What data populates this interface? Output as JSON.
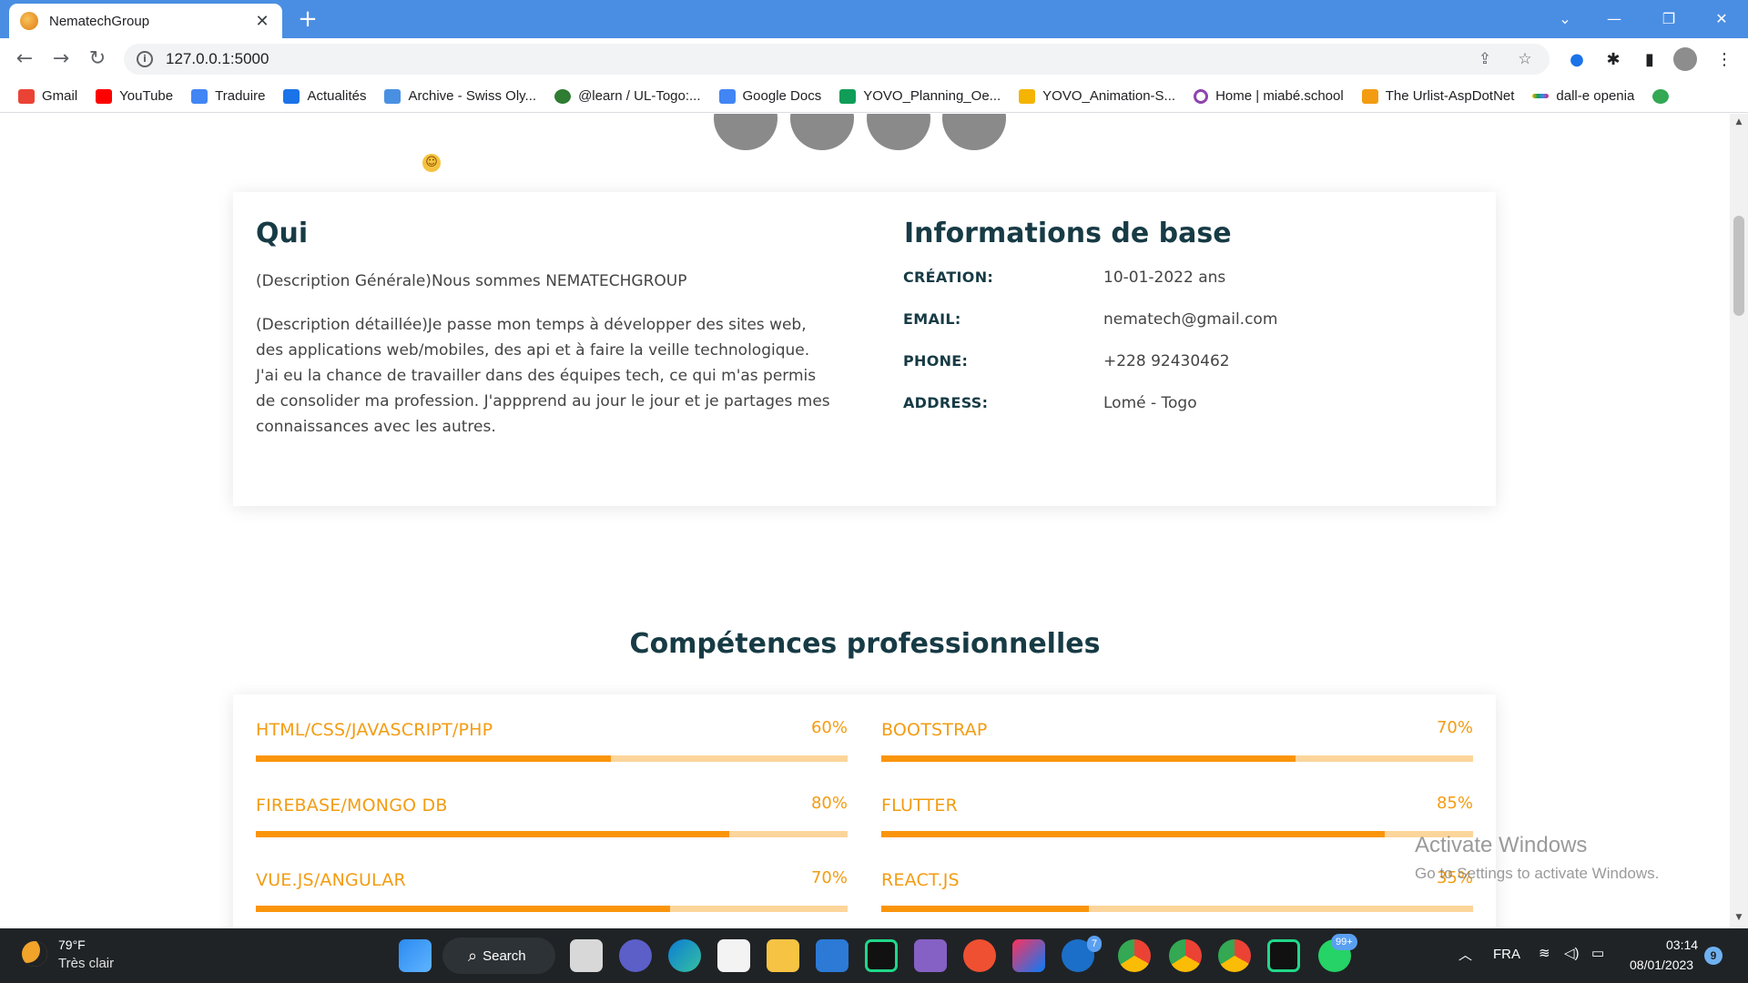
{
  "browser": {
    "tab_title": "NematechGroup",
    "tab_close": "✕",
    "new_tab": "+",
    "url": "127.0.0.1:5000",
    "window_controls": [
      "⌄",
      "—",
      "❐",
      "✕"
    ]
  },
  "bookmarks": [
    {
      "label": "Gmail",
      "color": "#ea4335"
    },
    {
      "label": "YouTube",
      "color": "#ff0000"
    },
    {
      "label": "Traduire",
      "color": "#4285f4"
    },
    {
      "label": "Actualités",
      "color": "#1a73e8"
    },
    {
      "label": "Archive - Swiss Oly...",
      "color": "#4a90e2"
    },
    {
      "label": "@learn / UL-Togo:...",
      "color": "#2e7d32"
    },
    {
      "label": "Google Docs",
      "color": "#4285f4"
    },
    {
      "label": "YOVO_Planning_Oe...",
      "color": "#0f9d58"
    },
    {
      "label": "YOVO_Animation-S...",
      "color": "#f4b400"
    },
    {
      "label": "Home | miabé.school",
      "color": "#8e44ad"
    },
    {
      "label": "The Urlist-AspDotNet",
      "color": "#f39c12"
    },
    {
      "label": "dall-e openia",
      "color": "#e91e63"
    }
  ],
  "about": {
    "heading": "Qui",
    "description_general": "(Description Générale)Nous sommes NEMATECHGROUP",
    "description_detailed": "(Description détaillée)Je passe mon temps à développer des sites web, des applications web/mobiles, des api et à faire la veille technologique. J'ai eu la chance de travailler dans des équipes tech, ce qui m'as permis de consolider ma profession. J'appprend au jour le jour et je partages mes connaissances avec les autres.",
    "info_heading": "Informations de base",
    "info": [
      {
        "label": "CRÉATION:",
        "value": "10-01-2022 ans"
      },
      {
        "label": "EMAIL:",
        "value": "nematech@gmail.com"
      },
      {
        "label": "PHONE:",
        "value": "+228 92430462"
      },
      {
        "label": "ADDRESS:",
        "value": "Lomé - Togo"
      }
    ]
  },
  "skills": {
    "title": "Compétences professionnelles",
    "items": [
      {
        "name": "HTML/CSS/JAVASCRIPT/PHP",
        "percent_label": "60%",
        "percent": 60
      },
      {
        "name": "BOOTSTRAP",
        "percent_label": "70%",
        "percent": 70
      },
      {
        "name": "FIREBASE/MONGO DB",
        "percent_label": "80%",
        "percent": 80
      },
      {
        "name": "FLUTTER",
        "percent_label": "85%",
        "percent": 85
      },
      {
        "name": "VUE.JS/ANGULAR",
        "percent_label": "70%",
        "percent": 70
      },
      {
        "name": "REACT.JS",
        "percent_label": "35%",
        "percent": 35
      }
    ]
  },
  "watermark": {
    "line1": "Activate Windows",
    "line2": "Go to Settings to activate Windows."
  },
  "taskbar": {
    "weather_temp": "79°F",
    "weather_desc": "Très clair",
    "search_label": "Search",
    "steam_badge": "7",
    "whatsapp_badge": "99+",
    "language": "FRA",
    "time": "03:14",
    "date": "08/01/2023",
    "notifications": "9"
  },
  "colors": {
    "accent": "#f39c12",
    "bar_fill": "#fa950b",
    "bar_track": "#fcd59b",
    "heading": "#173b45",
    "chrome_frame": "#4a8ee3"
  }
}
